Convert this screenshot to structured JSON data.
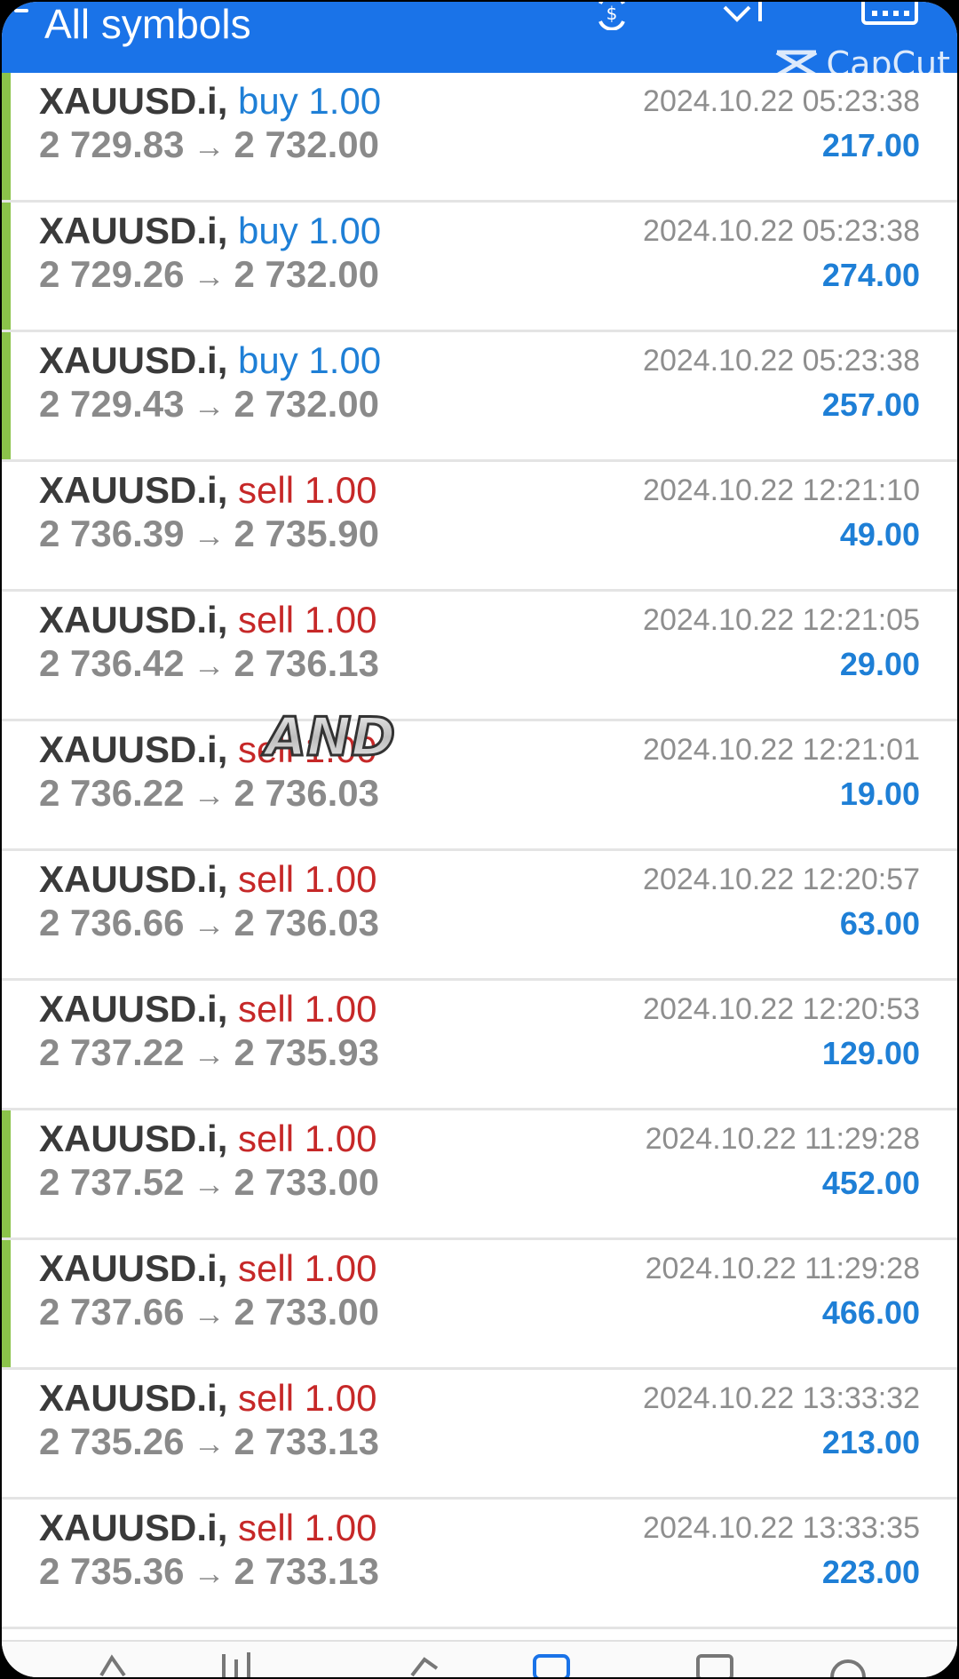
{
  "header": {
    "title": "All symbols",
    "icons": [
      "back-icon",
      "dollar-sync-icon",
      "sort-icon",
      "calendar-icon"
    ]
  },
  "watermark": {
    "capcut": "CapCut",
    "sticker": "AND"
  },
  "colors": {
    "header": "#1a73e8",
    "buy": "#1e7fd6",
    "sell": "#c62828",
    "profit": "#1e7fd6",
    "marker": "#8bc34a"
  },
  "trades": [
    {
      "symbol": "XAUUSD.i,",
      "direction": "buy",
      "volume": "1.00",
      "open": "2 729.83",
      "close": "2 732.00",
      "time": "2024.10.22 05:23:38",
      "profit": "217.00",
      "marked": true
    },
    {
      "symbol": "XAUUSD.i,",
      "direction": "buy",
      "volume": "1.00",
      "open": "2 729.26",
      "close": "2 732.00",
      "time": "2024.10.22 05:23:38",
      "profit": "274.00",
      "marked": true
    },
    {
      "symbol": "XAUUSD.i,",
      "direction": "buy",
      "volume": "1.00",
      "open": "2 729.43",
      "close": "2 732.00",
      "time": "2024.10.22 05:23:38",
      "profit": "257.00",
      "marked": true
    },
    {
      "symbol": "XAUUSD.i,",
      "direction": "sell",
      "volume": "1.00",
      "open": "2 736.39",
      "close": "2 735.90",
      "time": "2024.10.22 12:21:10",
      "profit": "49.00",
      "marked": false
    },
    {
      "symbol": "XAUUSD.i,",
      "direction": "sell",
      "volume": "1.00",
      "open": "2 736.42",
      "close": "2 736.13",
      "time": "2024.10.22 12:21:05",
      "profit": "29.00",
      "marked": false
    },
    {
      "symbol": "XAUUSD.i,",
      "direction": "sell",
      "volume": "1.00",
      "open": "2 736.22",
      "close": "2 736.03",
      "time": "2024.10.22 12:21:01",
      "profit": "19.00",
      "marked": false
    },
    {
      "symbol": "XAUUSD.i,",
      "direction": "sell",
      "volume": "1.00",
      "open": "2 736.66",
      "close": "2 736.03",
      "time": "2024.10.22 12:20:57",
      "profit": "63.00",
      "marked": false
    },
    {
      "symbol": "XAUUSD.i,",
      "direction": "sell",
      "volume": "1.00",
      "open": "2 737.22",
      "close": "2 735.93",
      "time": "2024.10.22 12:20:53",
      "profit": "129.00",
      "marked": false
    },
    {
      "symbol": "XAUUSD.i,",
      "direction": "sell",
      "volume": "1.00",
      "open": "2 737.52",
      "close": "2 733.00",
      "time": "2024.10.22 11:29:28",
      "profit": "452.00",
      "marked": true
    },
    {
      "symbol": "XAUUSD.i,",
      "direction": "sell",
      "volume": "1.00",
      "open": "2 737.66",
      "close": "2 733.00",
      "time": "2024.10.22 11:29:28",
      "profit": "466.00",
      "marked": true
    },
    {
      "symbol": "XAUUSD.i,",
      "direction": "sell",
      "volume": "1.00",
      "open": "2 735.26",
      "close": "2 733.13",
      "time": "2024.10.22 13:33:32",
      "profit": "213.00",
      "marked": false
    },
    {
      "symbol": "XAUUSD.i,",
      "direction": "sell",
      "volume": "1.00",
      "open": "2 735.36",
      "close": "2 733.13",
      "time": "2024.10.22 13:33:35",
      "profit": "223.00",
      "marked": false
    }
  ],
  "bottom_nav": [
    "quotes-icon",
    "chart-icon",
    "trade-icon",
    "history-icon",
    "messages-icon",
    "settings-icon"
  ]
}
